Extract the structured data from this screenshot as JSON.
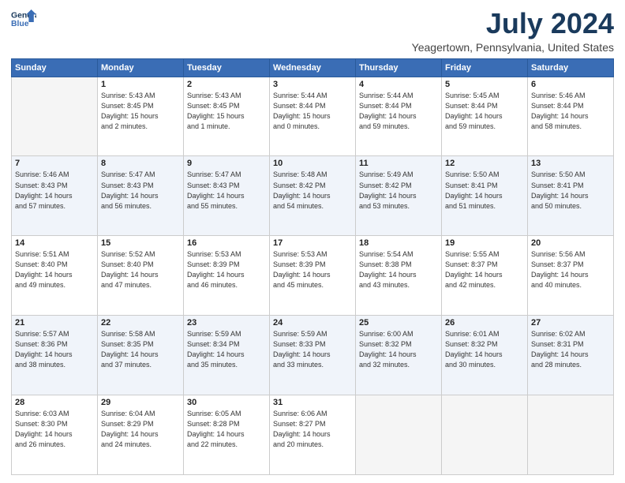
{
  "logo": {
    "line1": "General",
    "line2": "Blue"
  },
  "title": "July 2024",
  "subtitle": "Yeagertown, Pennsylvania, United States",
  "days_of_week": [
    "Sunday",
    "Monday",
    "Tuesday",
    "Wednesday",
    "Thursday",
    "Friday",
    "Saturday"
  ],
  "weeks": [
    [
      {
        "day": "",
        "info": ""
      },
      {
        "day": "1",
        "info": "Sunrise: 5:43 AM\nSunset: 8:45 PM\nDaylight: 15 hours\nand 2 minutes."
      },
      {
        "day": "2",
        "info": "Sunrise: 5:43 AM\nSunset: 8:45 PM\nDaylight: 15 hours\nand 1 minute."
      },
      {
        "day": "3",
        "info": "Sunrise: 5:44 AM\nSunset: 8:44 PM\nDaylight: 15 hours\nand 0 minutes."
      },
      {
        "day": "4",
        "info": "Sunrise: 5:44 AM\nSunset: 8:44 PM\nDaylight: 14 hours\nand 59 minutes."
      },
      {
        "day": "5",
        "info": "Sunrise: 5:45 AM\nSunset: 8:44 PM\nDaylight: 14 hours\nand 59 minutes."
      },
      {
        "day": "6",
        "info": "Sunrise: 5:46 AM\nSunset: 8:44 PM\nDaylight: 14 hours\nand 58 minutes."
      }
    ],
    [
      {
        "day": "7",
        "info": "Sunrise: 5:46 AM\nSunset: 8:43 PM\nDaylight: 14 hours\nand 57 minutes."
      },
      {
        "day": "8",
        "info": "Sunrise: 5:47 AM\nSunset: 8:43 PM\nDaylight: 14 hours\nand 56 minutes."
      },
      {
        "day": "9",
        "info": "Sunrise: 5:47 AM\nSunset: 8:43 PM\nDaylight: 14 hours\nand 55 minutes."
      },
      {
        "day": "10",
        "info": "Sunrise: 5:48 AM\nSunset: 8:42 PM\nDaylight: 14 hours\nand 54 minutes."
      },
      {
        "day": "11",
        "info": "Sunrise: 5:49 AM\nSunset: 8:42 PM\nDaylight: 14 hours\nand 53 minutes."
      },
      {
        "day": "12",
        "info": "Sunrise: 5:50 AM\nSunset: 8:41 PM\nDaylight: 14 hours\nand 51 minutes."
      },
      {
        "day": "13",
        "info": "Sunrise: 5:50 AM\nSunset: 8:41 PM\nDaylight: 14 hours\nand 50 minutes."
      }
    ],
    [
      {
        "day": "14",
        "info": "Sunrise: 5:51 AM\nSunset: 8:40 PM\nDaylight: 14 hours\nand 49 minutes."
      },
      {
        "day": "15",
        "info": "Sunrise: 5:52 AM\nSunset: 8:40 PM\nDaylight: 14 hours\nand 47 minutes."
      },
      {
        "day": "16",
        "info": "Sunrise: 5:53 AM\nSunset: 8:39 PM\nDaylight: 14 hours\nand 46 minutes."
      },
      {
        "day": "17",
        "info": "Sunrise: 5:53 AM\nSunset: 8:39 PM\nDaylight: 14 hours\nand 45 minutes."
      },
      {
        "day": "18",
        "info": "Sunrise: 5:54 AM\nSunset: 8:38 PM\nDaylight: 14 hours\nand 43 minutes."
      },
      {
        "day": "19",
        "info": "Sunrise: 5:55 AM\nSunset: 8:37 PM\nDaylight: 14 hours\nand 42 minutes."
      },
      {
        "day": "20",
        "info": "Sunrise: 5:56 AM\nSunset: 8:37 PM\nDaylight: 14 hours\nand 40 minutes."
      }
    ],
    [
      {
        "day": "21",
        "info": "Sunrise: 5:57 AM\nSunset: 8:36 PM\nDaylight: 14 hours\nand 38 minutes."
      },
      {
        "day": "22",
        "info": "Sunrise: 5:58 AM\nSunset: 8:35 PM\nDaylight: 14 hours\nand 37 minutes."
      },
      {
        "day": "23",
        "info": "Sunrise: 5:59 AM\nSunset: 8:34 PM\nDaylight: 14 hours\nand 35 minutes."
      },
      {
        "day": "24",
        "info": "Sunrise: 5:59 AM\nSunset: 8:33 PM\nDaylight: 14 hours\nand 33 minutes."
      },
      {
        "day": "25",
        "info": "Sunrise: 6:00 AM\nSunset: 8:32 PM\nDaylight: 14 hours\nand 32 minutes."
      },
      {
        "day": "26",
        "info": "Sunrise: 6:01 AM\nSunset: 8:32 PM\nDaylight: 14 hours\nand 30 minutes."
      },
      {
        "day": "27",
        "info": "Sunrise: 6:02 AM\nSunset: 8:31 PM\nDaylight: 14 hours\nand 28 minutes."
      }
    ],
    [
      {
        "day": "28",
        "info": "Sunrise: 6:03 AM\nSunset: 8:30 PM\nDaylight: 14 hours\nand 26 minutes."
      },
      {
        "day": "29",
        "info": "Sunrise: 6:04 AM\nSunset: 8:29 PM\nDaylight: 14 hours\nand 24 minutes."
      },
      {
        "day": "30",
        "info": "Sunrise: 6:05 AM\nSunset: 8:28 PM\nDaylight: 14 hours\nand 22 minutes."
      },
      {
        "day": "31",
        "info": "Sunrise: 6:06 AM\nSunset: 8:27 PM\nDaylight: 14 hours\nand 20 minutes."
      },
      {
        "day": "",
        "info": ""
      },
      {
        "day": "",
        "info": ""
      },
      {
        "day": "",
        "info": ""
      }
    ]
  ]
}
